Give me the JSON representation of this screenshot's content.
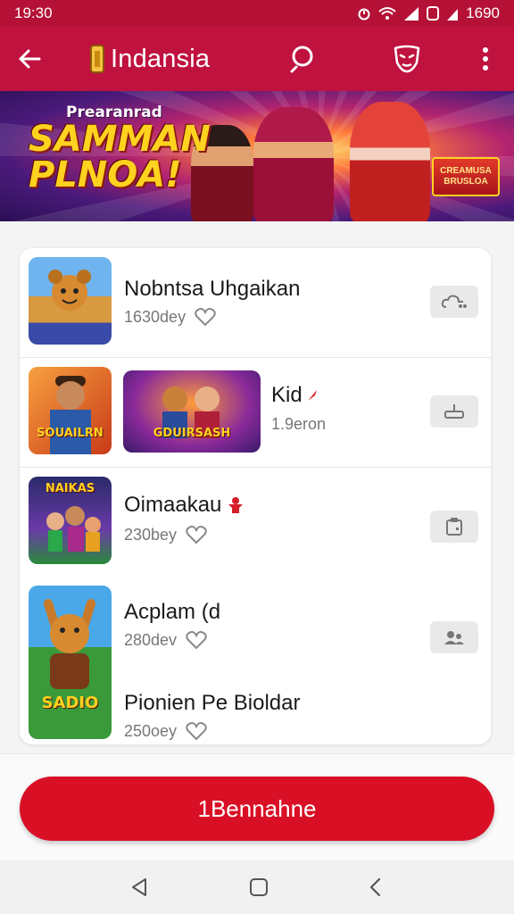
{
  "status_bar": {
    "time": "19:30",
    "battery_time": "1690"
  },
  "app_bar": {
    "title": "Indansia"
  },
  "banner": {
    "small_text": "Prearanrad",
    "big_text": "SAMMAN PLNOA!",
    "sign_text": "CREAMUSA BRUSLOA"
  },
  "items": [
    {
      "title": "Nobntsa Uhgaikan",
      "meta": "1630dey",
      "has_heart": true
    },
    {
      "title": "Kid",
      "meta": "1.9eron",
      "has_heart": false,
      "thumb_caption": "SOUAILRN",
      "wide_caption": "GDUIRSASH"
    },
    {
      "title": "Oimaakau",
      "meta": "230bey",
      "has_heart": true,
      "thumb_caption": "NAIKAS"
    },
    {
      "title": "Acplam (d",
      "meta": "280dev",
      "has_heart": true,
      "thumb_caption": "SADIO"
    },
    {
      "title": "Pionien Pe Bioldar",
      "meta": "250oey",
      "has_heart": true
    }
  ],
  "cta": {
    "label": "1Bennahne"
  },
  "colors": {
    "brand": "#c0123f",
    "cta": "#d90f25",
    "status": "#b51136"
  },
  "icons": [
    "back-arrow-icon",
    "search-icon",
    "mask-icon",
    "more-vert-icon",
    "heart-icon",
    "triangle-back-icon",
    "square-home-icon",
    "chevron-back-icon"
  ]
}
